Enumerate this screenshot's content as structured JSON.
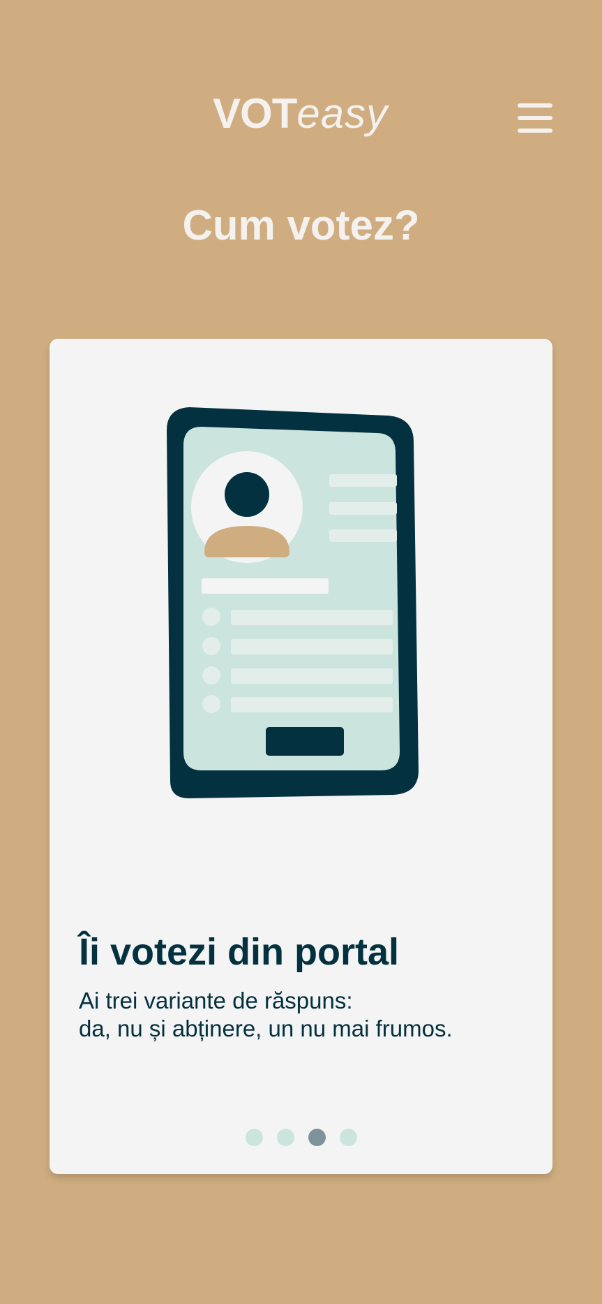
{
  "header": {
    "logo_bold": "VOT",
    "logo_light": "easy",
    "menu_icon": "hamburger-menu-icon"
  },
  "page_title": "Cum votez?",
  "card": {
    "illustration_icon": "phone-voting-ballot-icon",
    "title": "Îi votezi din portal",
    "description_lines": [
      "Ai trei variante de răspuns:",
      "da, nu și abținere, un nu mai frumos."
    ],
    "pagination": {
      "total": 4,
      "active": 3
    }
  },
  "colors": {
    "background": "#CFAD80",
    "card": "#F4F4F4",
    "dark": "#04313F",
    "screen": "#CBE5DE",
    "dot_inactive": "#CBE5DE",
    "dot_active": "#7E929B",
    "text_light": "#F4F1EE"
  }
}
